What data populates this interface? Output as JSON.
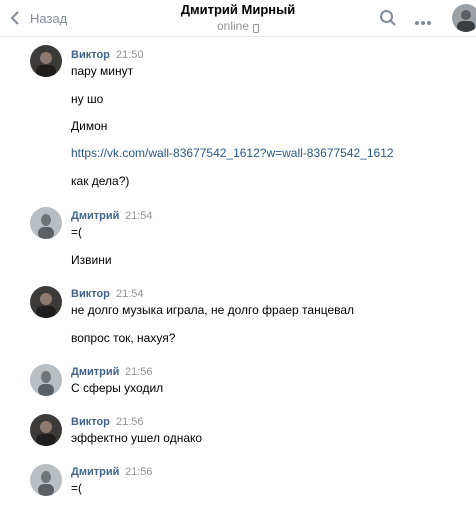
{
  "header": {
    "back_label": "Назад",
    "title": "Дмитрий Мирный",
    "status": "online"
  },
  "messages": [
    {
      "author": "Виктор",
      "time": "21:50",
      "texts": [
        "пару минут",
        "ну шо",
        "Димон",
        "https://vk.com/wall-83677542_1612?w=wall-83677542_1612",
        "как дела?)"
      ]
    },
    {
      "author": "Дмитрий",
      "time": "21:54",
      "texts": [
        "=(",
        "Извини"
      ]
    },
    {
      "author": "Виктор",
      "time": "21:54",
      "texts": [
        "не долго музыка играла, не долго фраер танцевал",
        "вопрос ток, нахуя?"
      ]
    },
    {
      "author": "Дмитрий",
      "time": "21:56",
      "texts": [
        "С сферы уходил"
      ]
    },
    {
      "author": "Виктор",
      "time": "21:56",
      "texts": [
        "эффектно ушел однако"
      ]
    },
    {
      "author": "Дмитрий",
      "time": "21:56",
      "texts": [
        "=("
      ]
    }
  ],
  "icons": [
    "chevron-left-icon",
    "phone-icon",
    "search-icon",
    "more-icon"
  ],
  "colors": {
    "author": "#42648b",
    "link": "#2a5885",
    "muted": "#939393",
    "divider": "#e7e8ec"
  }
}
